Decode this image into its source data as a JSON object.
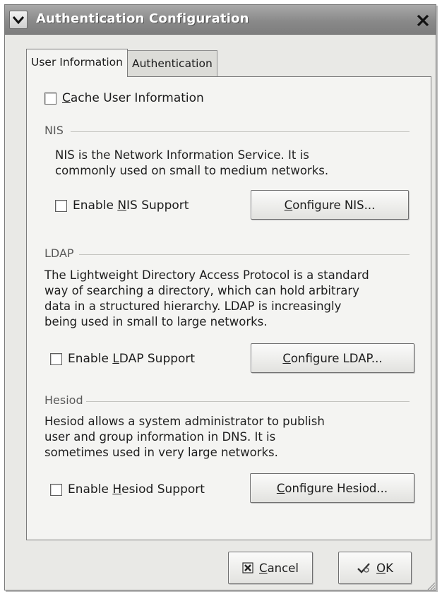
{
  "window": {
    "title": "Authentication Configuration"
  },
  "tabs": [
    {
      "label": "User Information",
      "active": true
    },
    {
      "label": "Authentication",
      "active": false
    }
  ],
  "cache": {
    "mnemonic": "C",
    "label_rest": "ache User Information",
    "checked": false
  },
  "nis": {
    "title": "NIS",
    "description": "NIS is the Network Information Service.  It is\ncommonly used on small to medium networks.",
    "enable_prefix": "Enable ",
    "enable_mnemonic": "N",
    "enable_suffix": "IS Support",
    "checked": false,
    "configure_mnemonic": "C",
    "configure_rest": "onfigure NIS..."
  },
  "ldap": {
    "title": "LDAP",
    "description": "The Lightweight Directory Access Protocol is a standard\nway of searching a directory, which can hold arbitrary\ndata in a structured hierarchy.  LDAP is increasingly\nbeing used in small to large networks.",
    "enable_prefix": "Enable ",
    "enable_mnemonic": "L",
    "enable_suffix": "DAP Support",
    "checked": false,
    "configure_mnemonic": "C",
    "configure_rest": "onfigure LDAP..."
  },
  "hesiod": {
    "title": "Hesiod",
    "description": "Hesiod allows a system administrator to publish\nuser and group information in DNS.  It is\nsometimes used in very large networks.",
    "enable_prefix": "Enable ",
    "enable_mnemonic": "H",
    "enable_suffix": "esiod Support",
    "checked": false,
    "configure_mnemonic": "C",
    "configure_rest": "onfigure Hesiod..."
  },
  "footer": {
    "cancel_mnemonic": "C",
    "cancel_rest": "ancel",
    "ok_mnemonic": "O",
    "ok_rest": "K"
  },
  "icons": {
    "window_menu": "chevron-down-icon",
    "close": "close-icon",
    "cancel": "cancel-icon",
    "ok": "ok-icon"
  }
}
